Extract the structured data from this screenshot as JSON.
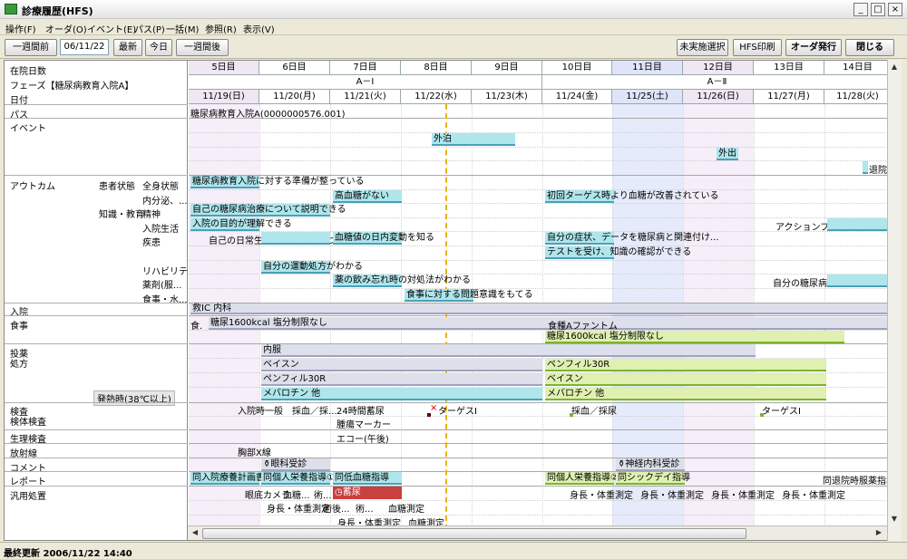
{
  "window": {
    "title": "診療履歴(HFS)",
    "min": "_",
    "max": "□",
    "close": "×"
  },
  "menu": [
    "操作(F)",
    "オーダ(O)",
    "イベント(E)",
    "パス(P)",
    "一括(M)",
    "参照(R)",
    "表示(V)"
  ],
  "toolbar": {
    "prev_week": "一週間前",
    "date": "06/11/22",
    "latest": "最新",
    "today": "今日",
    "next_week": "一週間後",
    "unexecuted": "未実施選択",
    "hfs_print": "HFS印刷",
    "order_issue": "オーダ発行",
    "close": "閉じる"
  },
  "left": {
    "days_label": "在院日数",
    "phase_label": "フェーズ【糖尿病教育入院A】",
    "date_label": "日付",
    "path": "パス",
    "event": "イベント",
    "outcome": "アウトカム",
    "patient_state": "患者状態",
    "systemic": "全身状態",
    "endocrine": "内分泌、...",
    "knowledge": "知識・教育",
    "mental": "精神",
    "inpatient_life": "入院生活",
    "disease": "疾患",
    "rehab": "リハビリテ...",
    "drug": "薬剤(服...",
    "meal_water": "食事・水...",
    "admission": "入院",
    "meal": "食事",
    "medication": "投薬",
    "prescription": "処方",
    "fever": "発熱時(38℃以上)",
    "exam": "検査",
    "specimen": "検体検査",
    "physio": "生理検査",
    "radiology": "放射線",
    "comment": "コメント",
    "report": "レポート",
    "general": "汎用処置"
  },
  "days": [
    "5日目",
    "6日目",
    "7日目",
    "8日目",
    "9日目",
    "10日目",
    "11日目",
    "12日目",
    "13日目",
    "14日目"
  ],
  "phases": [
    "A－Ⅰ",
    "A－Ⅱ"
  ],
  "dates": [
    "11/19(日)",
    "11/20(月)",
    "11/21(火)",
    "11/22(水)",
    "11/23(木)",
    "11/24(金)",
    "11/25(土)",
    "11/26(日)",
    "11/27(月)",
    "11/28(火)"
  ],
  "path_text": "糖尿病教育入院A(0000000576.001)",
  "events": {
    "gaihaku": "外泊",
    "gaishutsu": "外出",
    "taiin": "退院"
  },
  "outcomes": {
    "o1": "糖尿病教育入院に対する準備が整っている",
    "o2": "高血糖がない",
    "o3": "初回ターゲス時より血糖が改善されている",
    "o4": "自己の糖尿病治療について説明できる",
    "o5": "入院の目的が理解できる",
    "o6": "アクションプランの意味がわかる",
    "o7": "自己の日常生活の問題点に気づく",
    "o8": "血糖値の日内変動を知る",
    "o9": "自分の症状、データを糖尿病と関連付け...",
    "o10": "テストを受け、知識の確認ができる",
    "o11": "自分の運動処方がわかる",
    "o12": "薬の飲み忘れ時の対処法がわかる",
    "o13": "自分の糖尿病薬の名前がわかる",
    "o14": "食事に対する問題意識をもてる"
  },
  "admission_text": "救IC 内科",
  "meals": {
    "m1": "食.",
    "m2": "糖尿1600kcal 塩分制限なし",
    "m3": "食種Aファントム",
    "m4": "糖尿1600kcal 塩分制限なし"
  },
  "prescriptions": {
    "p1": "内服",
    "p2": "ベイスン",
    "p3": "ペンフィル30R",
    "p4": "メバロチン 他",
    "p5": "ペンフィル30R",
    "p6": "ベイスン",
    "p7": "メバロチン 他"
  },
  "exams": {
    "e1": "入院時一般",
    "e2": "採血／採...",
    "e3": "24時間蓄尿",
    "e4": "ターゲスⅠ",
    "e5": "採血／採尿",
    "e6": "ターゲスⅠ",
    "e7": "腫瘍マーカー",
    "e8": "エコー(午後)",
    "e9": "胸部X線"
  },
  "comments": {
    "c1": "眼科受診",
    "c2": "神経内科受診"
  },
  "reports": {
    "r1": "同入院療養計画書",
    "r2": "同個人栄養指導①",
    "r3": "同低血糖指導",
    "r4": "同個人栄養指導②",
    "r5": "同シックデイ指導",
    "r6": "同退院時服薬指導"
  },
  "general": {
    "g1": "眼底カメラ",
    "g2": "血糖...",
    "g3": "術...",
    "g4": "蓄尿",
    "g5": "身長・体重測定",
    "g6": "身長・体重測定",
    "g7": "身長・体重測定",
    "g8": "身長・体重測定",
    "g9": "身長・体重測定",
    "g10": "術後...",
    "g11": "術...",
    "g12": "血糖測定",
    "g13": "身長・体重測定",
    "g14": "血糖測定"
  },
  "status": "最終更新 2006/11/22 14:40",
  "colors": {
    "today_col": "#dfe4fa",
    "weekend": "#f4eaf6",
    "cyan": "#aee6ec",
    "lime": "#dff0b0",
    "grey": "#dde0ea"
  }
}
